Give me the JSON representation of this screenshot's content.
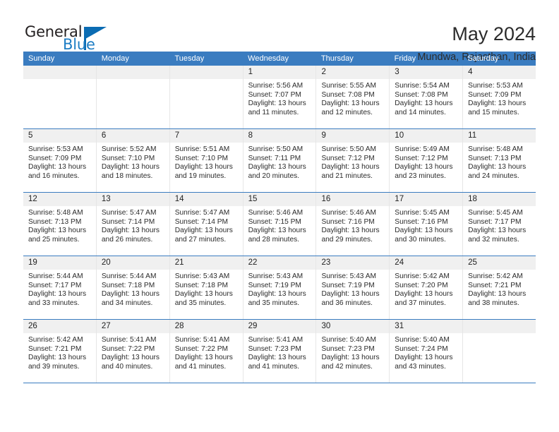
{
  "logo": {
    "word_top": "General",
    "word_bottom": "Blue",
    "accent_color": "#0b6cb3"
  },
  "header": {
    "title": "May 2024",
    "subtitle": "Mundwa, Rajasthan, India"
  },
  "theme": {
    "header_blue": "#3a7cc0",
    "daynum_bg": "#f0f0f0",
    "text": "#2b2b2b"
  },
  "calendar": {
    "weekdays": [
      "Sunday",
      "Monday",
      "Tuesday",
      "Wednesday",
      "Thursday",
      "Friday",
      "Saturday"
    ],
    "weeks": [
      [
        {
          "day": "",
          "sunrise": "",
          "sunset": "",
          "daylight": ""
        },
        {
          "day": "",
          "sunrise": "",
          "sunset": "",
          "daylight": ""
        },
        {
          "day": "",
          "sunrise": "",
          "sunset": "",
          "daylight": ""
        },
        {
          "day": "1",
          "sunrise": "Sunrise: 5:56 AM",
          "sunset": "Sunset: 7:07 PM",
          "daylight": "Daylight: 13 hours and 11 minutes."
        },
        {
          "day": "2",
          "sunrise": "Sunrise: 5:55 AM",
          "sunset": "Sunset: 7:08 PM",
          "daylight": "Daylight: 13 hours and 12 minutes."
        },
        {
          "day": "3",
          "sunrise": "Sunrise: 5:54 AM",
          "sunset": "Sunset: 7:08 PM",
          "daylight": "Daylight: 13 hours and 14 minutes."
        },
        {
          "day": "4",
          "sunrise": "Sunrise: 5:53 AM",
          "sunset": "Sunset: 7:09 PM",
          "daylight": "Daylight: 13 hours and 15 minutes."
        }
      ],
      [
        {
          "day": "5",
          "sunrise": "Sunrise: 5:53 AM",
          "sunset": "Sunset: 7:09 PM",
          "daylight": "Daylight: 13 hours and 16 minutes."
        },
        {
          "day": "6",
          "sunrise": "Sunrise: 5:52 AM",
          "sunset": "Sunset: 7:10 PM",
          "daylight": "Daylight: 13 hours and 18 minutes."
        },
        {
          "day": "7",
          "sunrise": "Sunrise: 5:51 AM",
          "sunset": "Sunset: 7:10 PM",
          "daylight": "Daylight: 13 hours and 19 minutes."
        },
        {
          "day": "8",
          "sunrise": "Sunrise: 5:50 AM",
          "sunset": "Sunset: 7:11 PM",
          "daylight": "Daylight: 13 hours and 20 minutes."
        },
        {
          "day": "9",
          "sunrise": "Sunrise: 5:50 AM",
          "sunset": "Sunset: 7:12 PM",
          "daylight": "Daylight: 13 hours and 21 minutes."
        },
        {
          "day": "10",
          "sunrise": "Sunrise: 5:49 AM",
          "sunset": "Sunset: 7:12 PM",
          "daylight": "Daylight: 13 hours and 23 minutes."
        },
        {
          "day": "11",
          "sunrise": "Sunrise: 5:48 AM",
          "sunset": "Sunset: 7:13 PM",
          "daylight": "Daylight: 13 hours and 24 minutes."
        }
      ],
      [
        {
          "day": "12",
          "sunrise": "Sunrise: 5:48 AM",
          "sunset": "Sunset: 7:13 PM",
          "daylight": "Daylight: 13 hours and 25 minutes."
        },
        {
          "day": "13",
          "sunrise": "Sunrise: 5:47 AM",
          "sunset": "Sunset: 7:14 PM",
          "daylight": "Daylight: 13 hours and 26 minutes."
        },
        {
          "day": "14",
          "sunrise": "Sunrise: 5:47 AM",
          "sunset": "Sunset: 7:14 PM",
          "daylight": "Daylight: 13 hours and 27 minutes."
        },
        {
          "day": "15",
          "sunrise": "Sunrise: 5:46 AM",
          "sunset": "Sunset: 7:15 PM",
          "daylight": "Daylight: 13 hours and 28 minutes."
        },
        {
          "day": "16",
          "sunrise": "Sunrise: 5:46 AM",
          "sunset": "Sunset: 7:16 PM",
          "daylight": "Daylight: 13 hours and 29 minutes."
        },
        {
          "day": "17",
          "sunrise": "Sunrise: 5:45 AM",
          "sunset": "Sunset: 7:16 PM",
          "daylight": "Daylight: 13 hours and 30 minutes."
        },
        {
          "day": "18",
          "sunrise": "Sunrise: 5:45 AM",
          "sunset": "Sunset: 7:17 PM",
          "daylight": "Daylight: 13 hours and 32 minutes."
        }
      ],
      [
        {
          "day": "19",
          "sunrise": "Sunrise: 5:44 AM",
          "sunset": "Sunset: 7:17 PM",
          "daylight": "Daylight: 13 hours and 33 minutes."
        },
        {
          "day": "20",
          "sunrise": "Sunrise: 5:44 AM",
          "sunset": "Sunset: 7:18 PM",
          "daylight": "Daylight: 13 hours and 34 minutes."
        },
        {
          "day": "21",
          "sunrise": "Sunrise: 5:43 AM",
          "sunset": "Sunset: 7:18 PM",
          "daylight": "Daylight: 13 hours and 35 minutes."
        },
        {
          "day": "22",
          "sunrise": "Sunrise: 5:43 AM",
          "sunset": "Sunset: 7:19 PM",
          "daylight": "Daylight: 13 hours and 35 minutes."
        },
        {
          "day": "23",
          "sunrise": "Sunrise: 5:43 AM",
          "sunset": "Sunset: 7:19 PM",
          "daylight": "Daylight: 13 hours and 36 minutes."
        },
        {
          "day": "24",
          "sunrise": "Sunrise: 5:42 AM",
          "sunset": "Sunset: 7:20 PM",
          "daylight": "Daylight: 13 hours and 37 minutes."
        },
        {
          "day": "25",
          "sunrise": "Sunrise: 5:42 AM",
          "sunset": "Sunset: 7:21 PM",
          "daylight": "Daylight: 13 hours and 38 minutes."
        }
      ],
      [
        {
          "day": "26",
          "sunrise": "Sunrise: 5:42 AM",
          "sunset": "Sunset: 7:21 PM",
          "daylight": "Daylight: 13 hours and 39 minutes."
        },
        {
          "day": "27",
          "sunrise": "Sunrise: 5:41 AM",
          "sunset": "Sunset: 7:22 PM",
          "daylight": "Daylight: 13 hours and 40 minutes."
        },
        {
          "day": "28",
          "sunrise": "Sunrise: 5:41 AM",
          "sunset": "Sunset: 7:22 PM",
          "daylight": "Daylight: 13 hours and 41 minutes."
        },
        {
          "day": "29",
          "sunrise": "Sunrise: 5:41 AM",
          "sunset": "Sunset: 7:23 PM",
          "daylight": "Daylight: 13 hours and 41 minutes."
        },
        {
          "day": "30",
          "sunrise": "Sunrise: 5:40 AM",
          "sunset": "Sunset: 7:23 PM",
          "daylight": "Daylight: 13 hours and 42 minutes."
        },
        {
          "day": "31",
          "sunrise": "Sunrise: 5:40 AM",
          "sunset": "Sunset: 7:24 PM",
          "daylight": "Daylight: 13 hours and 43 minutes."
        },
        {
          "day": "",
          "sunrise": "",
          "sunset": "",
          "daylight": ""
        }
      ]
    ]
  }
}
